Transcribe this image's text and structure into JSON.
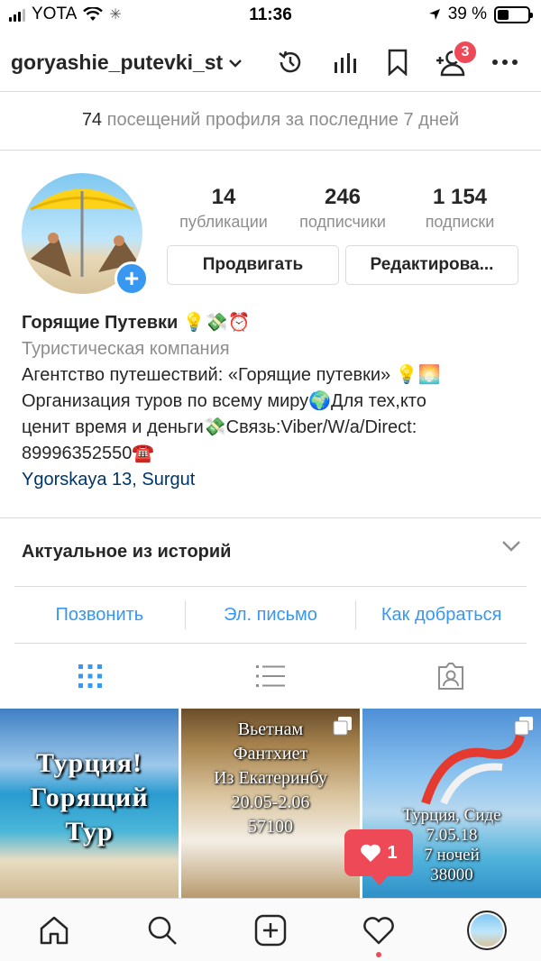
{
  "status_bar": {
    "carrier": "YOTA",
    "time": "11:36",
    "battery": "39 %",
    "battery_level": 0.39
  },
  "header": {
    "username": "goryashie_putevki_st",
    "notification_count": "3"
  },
  "visits": {
    "count": "74",
    "text": "посещений профиля за последние 7 дней"
  },
  "profile": {
    "stats": [
      {
        "value": "14",
        "label": "публикации"
      },
      {
        "value": "246",
        "label": "подписчики"
      },
      {
        "value": "1 154",
        "label": "подписки"
      }
    ],
    "promote_label": "Продвигать",
    "edit_label": "Редактирова...",
    "name": "Горящие Путевки 💡💸⏰",
    "category": "Туристическая компания",
    "bio_lines": [
      "Агентство путешествий: «Горящие путевки» 💡🌅",
      "Организация туров по всему миру🌍Для тех,кто",
      "ценит время и деньги💸Связь:Viber/W/a/Direct:",
      "89996352550☎️"
    ],
    "location": "Ygorskaya 13, Surgut"
  },
  "highlights": {
    "title": "Актуальное из историй"
  },
  "contact": {
    "call": "Позвонить",
    "email": "Эл. письмо",
    "directions": "Как добраться"
  },
  "posts": [
    {
      "lines": [
        "Турция!",
        "Горящий",
        "Тур"
      ]
    },
    {
      "lines": [
        "Вьетнам",
        "Фантхиет",
        "Из Екатеринбу",
        "20.05-2.06",
        "57100"
      ]
    },
    {
      "lines": [
        "Турция, Сиде",
        "7.05.18",
        "7 ночей",
        "38000"
      ]
    }
  ],
  "like_toast": {
    "count": "1"
  },
  "colors": {
    "accent": "#3897f0",
    "badge": "#ed4956",
    "link": "#003569",
    "muted": "#8e8e8e"
  }
}
